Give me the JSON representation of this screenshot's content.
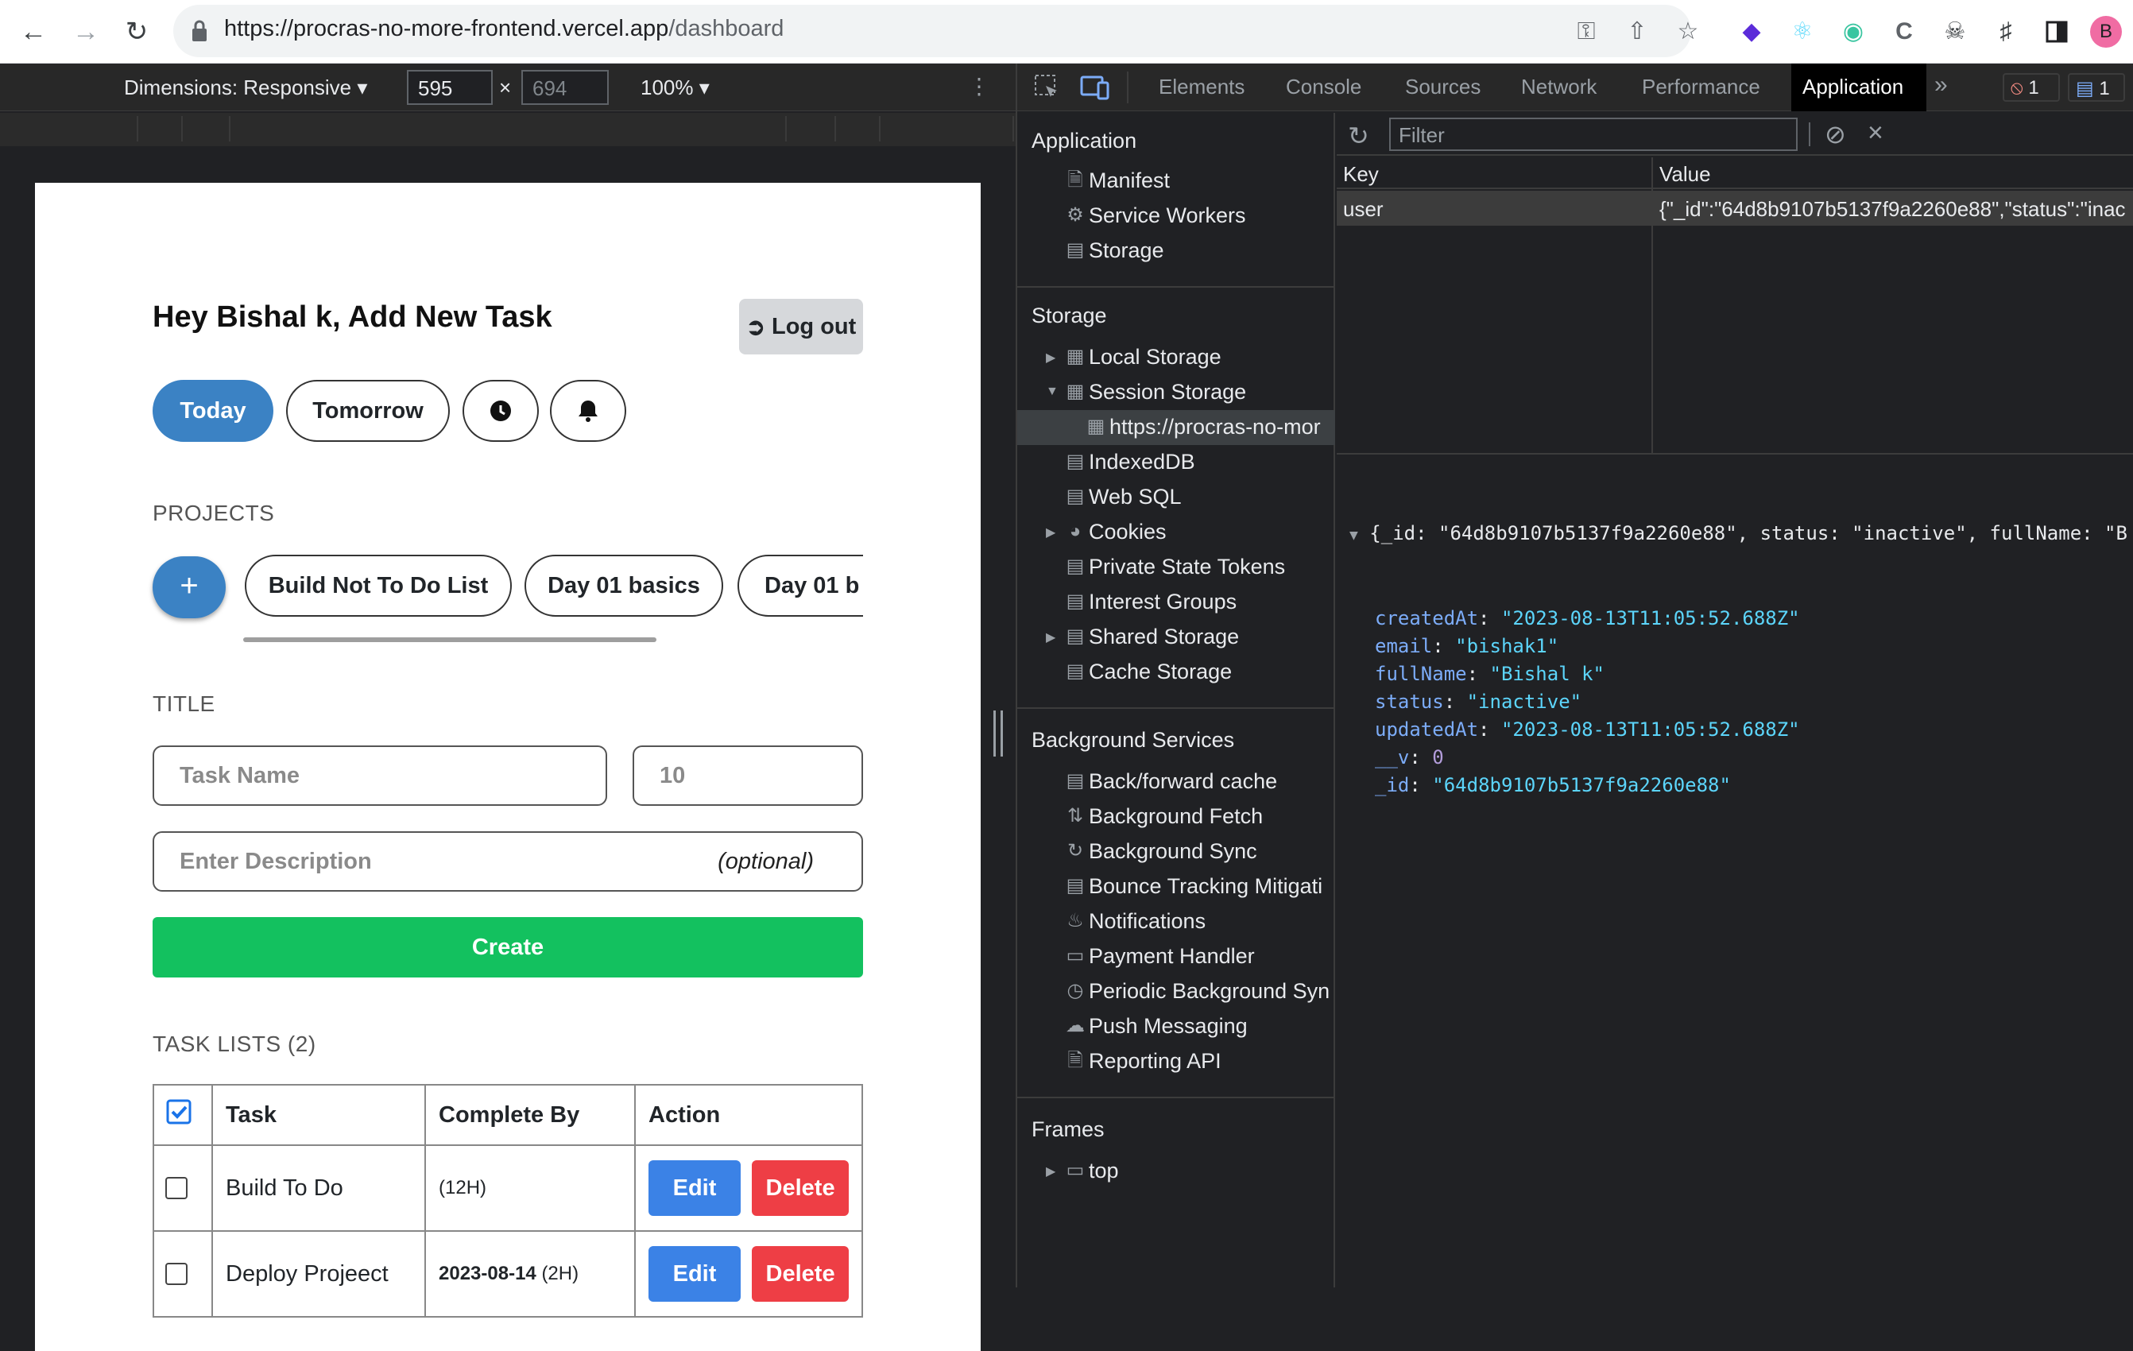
{
  "browser": {
    "url_host": "https://procras-no-more-frontend.vercel.app",
    "url_path": "/dashboard",
    "profile_initial": "B"
  },
  "device_toolbar": {
    "dimensions_label": "Dimensions: Responsive",
    "width": "595",
    "height": "694",
    "zoom": "100%"
  },
  "app": {
    "heading": "Hey Bishal k, Add New Task",
    "logout_label": "Log out",
    "filters": {
      "today": "Today",
      "tomorrow": "Tomorrow"
    },
    "projects_label": "PROJECTS",
    "add_project": "+",
    "projects": [
      "Build Not To Do List",
      "Day 01 basics",
      "Day 01 b"
    ],
    "title_label": "TITLE",
    "task_name_placeholder": "Task Name",
    "hours_placeholder": "10",
    "description_placeholder": "Enter Description",
    "description_optional": "(optional)",
    "create_label": "Create",
    "task_lists_label": "TASK LISTS (2)",
    "table": {
      "headers": [
        "Task",
        "Complete By",
        "Action"
      ],
      "rows": [
        {
          "task": "Build To Do",
          "complete_date": "",
          "complete_hours": "(12H)"
        },
        {
          "task": "Deploy Projeect",
          "complete_date": "2023-08-14",
          "complete_hours": "(2H)"
        }
      ],
      "edit_label": "Edit",
      "delete_label": "Delete"
    }
  },
  "devtools": {
    "tabs": [
      "Elements",
      "Console",
      "Sources",
      "Network",
      "Performance",
      "Application"
    ],
    "active_tab": "Application",
    "error_count": "1",
    "message_count": "1",
    "sidebar": {
      "application_header": "Application",
      "application_items": [
        "Manifest",
        "Service Workers",
        "Storage"
      ],
      "storage_header": "Storage",
      "storage_items": [
        "Local Storage",
        "Session Storage",
        "https://procras-no-mor",
        "IndexedDB",
        "Web SQL",
        "Cookies",
        "Private State Tokens",
        "Interest Groups",
        "Shared Storage",
        "Cache Storage"
      ],
      "bg_header": "Background Services",
      "bg_items": [
        "Back/forward cache",
        "Background Fetch",
        "Background Sync",
        "Bounce Tracking Mitigati",
        "Notifications",
        "Payment Handler",
        "Periodic Background Syn",
        "Push Messaging",
        "Reporting API"
      ],
      "frames_header": "Frames",
      "frames_items": [
        "top"
      ]
    },
    "filter_placeholder": "Filter",
    "kv": {
      "key_header": "Key",
      "value_header": "Value",
      "key": "user",
      "value": "{\"_id\":\"64d8b9107b5137f9a2260e88\",\"status\":\"inac"
    },
    "json": {
      "summary": "{_id: \"64d8b9107b5137f9a2260e88\", status: \"inactive\", fullName: \"B",
      "fields": [
        {
          "k": "createdAt",
          "v": "\"2023-08-13T11:05:52.688Z\"",
          "kind": "s"
        },
        {
          "k": "email",
          "v": "\"bishak1\"",
          "kind": "s"
        },
        {
          "k": "fullName",
          "v": "\"Bishal k\"",
          "kind": "s"
        },
        {
          "k": "status",
          "v": "\"inactive\"",
          "kind": "s"
        },
        {
          "k": "updatedAt",
          "v": "\"2023-08-13T11:05:52.688Z\"",
          "kind": "s"
        },
        {
          "k": "__v",
          "v": "0",
          "kind": "n"
        },
        {
          "k": "_id",
          "v": "\"64d8b9107b5137f9a2260e88\"",
          "kind": "s"
        }
      ]
    }
  }
}
